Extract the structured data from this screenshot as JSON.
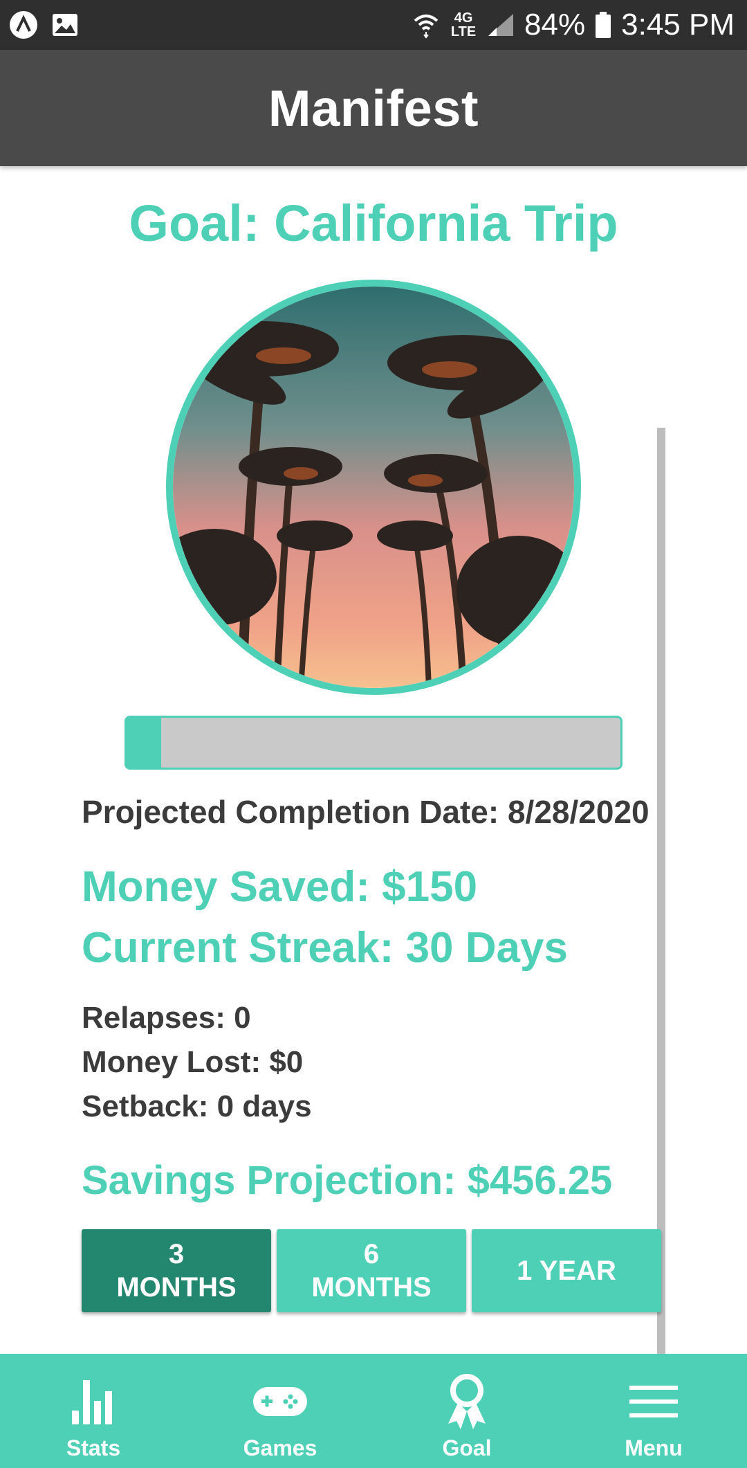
{
  "status_bar": {
    "battery": "84%",
    "time": "3:45 PM",
    "network": "4G LTE",
    "icons": [
      "app-launcher-icon",
      "image-icon",
      "wifi-icon",
      "lte-icon",
      "signal-icon",
      "battery-icon"
    ]
  },
  "app_bar": {
    "title": "Manifest"
  },
  "goal": {
    "title": "Goal: California Trip",
    "image_icon": "palm-trees-photo"
  },
  "progress": {
    "fraction": 0.07
  },
  "stats": {
    "projected_completion": "Projected Completion Date: 8/28/2020",
    "money_saved": "Money Saved: $150",
    "current_streak": "Current Streak: 30 Days",
    "relapses": "Relapses: 0",
    "money_lost": "Money Lost: $0",
    "setback": "Setback: 0 days",
    "savings_projection": "Savings Projection: $456.25"
  },
  "range_buttons": [
    {
      "label": "3\nMONTHS",
      "active": true
    },
    {
      "label": "6\nMONTHS",
      "active": false
    },
    {
      "label": "1 YEAR",
      "active": false
    }
  ],
  "bottom_nav": [
    {
      "label": "Stats",
      "icon": "bar-chart-icon"
    },
    {
      "label": "Games",
      "icon": "gamepad-icon"
    },
    {
      "label": "Goal",
      "icon": "award-ribbon-icon"
    },
    {
      "label": "Menu",
      "icon": "hamburger-menu-icon"
    }
  ],
  "colors": {
    "accent": "#4dd0b5",
    "accent_dark": "#23876f",
    "app_bar": "#4a4a4a",
    "status_bar": "#2f2f2f",
    "text_dark": "#3b3b3b"
  }
}
